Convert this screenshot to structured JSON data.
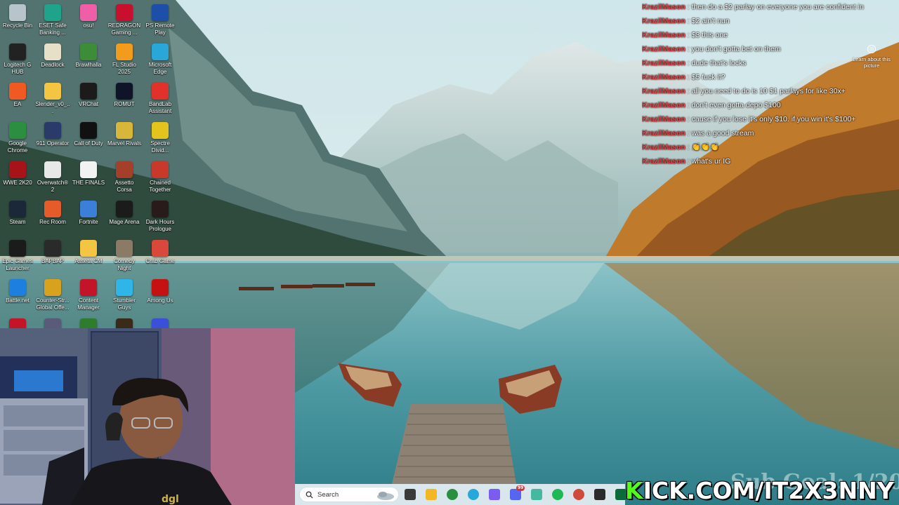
{
  "desktop": {
    "icons": [
      {
        "label": "Recycle Bin",
        "icon": "recycle-bin-icon",
        "color": "#b8c4cc"
      },
      {
        "label": "ESET Safe Banking ...",
        "icon": "eset-icon",
        "color": "#1fa38a"
      },
      {
        "label": "osu!",
        "icon": "osu-icon",
        "color": "#ee5fa8"
      },
      {
        "label": "REDRAGON Gaming ...",
        "icon": "redragon-icon",
        "color": "#c8102e"
      },
      {
        "label": "PS Remote Play",
        "icon": "ps-remote-play-icon",
        "color": "#1d4fa8"
      },
      {
        "label": "Logitech G HUB",
        "icon": "logitech-icon",
        "color": "#222222"
      },
      {
        "label": "Deadlock",
        "icon": "deadlock-icon",
        "color": "#e8dfc8"
      },
      {
        "label": "Brawlhalla",
        "icon": "brawlhalla-icon",
        "color": "#3d8c3a"
      },
      {
        "label": "FL Studio 2025",
        "icon": "fl-studio-icon",
        "color": "#f29b1c"
      },
      {
        "label": "Microsoft Edge",
        "icon": "edge-icon",
        "color": "#2aa7d9"
      },
      {
        "label": "EA",
        "icon": "ea-icon",
        "color": "#f05a22"
      },
      {
        "label": "Slender_v0_...",
        "icon": "folder-icon",
        "color": "#f4c542"
      },
      {
        "label": "VRChat",
        "icon": "vrchat-icon",
        "color": "#1b1b1b"
      },
      {
        "label": "ROMUT",
        "icon": "romut-icon",
        "color": "#101428"
      },
      {
        "label": "BandLab Assistant",
        "icon": "bandlab-icon",
        "color": "#e0322b"
      },
      {
        "label": "Google Chrome",
        "icon": "chrome-icon",
        "color": "#2c8f3f"
      },
      {
        "label": "911 Operator",
        "icon": "911-operator-icon",
        "color": "#2a3b6b"
      },
      {
        "label": "Call of Duty",
        "icon": "call-of-duty-icon",
        "color": "#111111"
      },
      {
        "label": "Marvel Rivals",
        "icon": "marvel-rivals-icon",
        "color": "#d8b63a"
      },
      {
        "label": "Spectre Divid...",
        "icon": "spectre-icon",
        "color": "#e3c31c"
      },
      {
        "label": "WWE 2K20",
        "icon": "wwe-icon",
        "color": "#a8131a"
      },
      {
        "label": "Overwatch® 2",
        "icon": "overwatch-icon",
        "color": "#e8e8e8"
      },
      {
        "label": "THE FINALS",
        "icon": "the-finals-icon",
        "color": "#f2f2f2"
      },
      {
        "label": "Assetto Corsa",
        "icon": "assetto-corsa-icon",
        "color": "#a4402a"
      },
      {
        "label": "Chained Together",
        "icon": "chained-together-icon",
        "color": "#c9392b"
      },
      {
        "label": "Steam",
        "icon": "steam-icon",
        "color": "#1b2838"
      },
      {
        "label": "Rec Room",
        "icon": "rec-room-icon",
        "color": "#e55b2a"
      },
      {
        "label": "Fortnite",
        "icon": "fortnite-icon",
        "color": "#3c7fd9"
      },
      {
        "label": "Mage Arena",
        "icon": "mage-arena-icon",
        "color": "#1b1b1b"
      },
      {
        "label": "Dark Hours Prologue",
        "icon": "dark-hours-icon",
        "color": "#2a1b1b"
      },
      {
        "label": "Epic Games Launcher",
        "icon": "epic-games-icon",
        "color": "#1b1b1b"
      },
      {
        "label": "BAPBAP",
        "icon": "bapbap-icon",
        "color": "#2a2a2a"
      },
      {
        "label": "Asseta CM",
        "icon": "folder-icon",
        "color": "#f4c542"
      },
      {
        "label": "Comedy Night",
        "icon": "comedy-night-icon",
        "color": "#8a7a66"
      },
      {
        "label": "Crab Game",
        "icon": "crab-game-icon",
        "color": "#d9483b"
      },
      {
        "label": "Battle.net",
        "icon": "battlenet-icon",
        "color": "#1d7fe0"
      },
      {
        "label": "Counter-Str... Global Offe...",
        "icon": "csgo-icon",
        "color": "#d9a21c"
      },
      {
        "label": "Content Manager",
        "icon": "content-manager-icon",
        "color": "#c3142a"
      },
      {
        "label": "Stumbler Guys",
        "icon": "stumble-guys-icon",
        "color": "#2fb5e8"
      },
      {
        "label": "Among Us",
        "icon": "among-us-icon",
        "color": "#c51111"
      }
    ]
  },
  "chat": {
    "separator": ":",
    "messages": [
      {
        "user": "KrazilMason",
        "text": "then do a $2 parlay on everyone you are confident in"
      },
      {
        "user": "KrazilMason",
        "text": "$2 ain't nun"
      },
      {
        "user": "KrazilMason",
        "text": "$3 this one"
      },
      {
        "user": "KrazilMason",
        "text": "you don't gotta bet on them"
      },
      {
        "user": "KrazilMason",
        "text": "dude that's locks"
      },
      {
        "user": "KrazilMason",
        "text": "$5 fuck it?"
      },
      {
        "user": "KrazilMason",
        "text": "all you need to do is 10 $1 parlays for like 30x+"
      },
      {
        "user": "KrazilMason",
        "text": "don't even gotta depo $100"
      },
      {
        "user": "KrazilMason",
        "text": "cause if you lose it's only $10. if you win it's $100+"
      },
      {
        "user": "KrazilMason",
        "text": "was a good stream"
      },
      {
        "user": "KrazilMason",
        "text": "👏👏👏"
      },
      {
        "user": "KrazilMason",
        "text": "what's ur IG"
      }
    ]
  },
  "learn_picture": {
    "label": "Learn about this picture"
  },
  "taskbar": {
    "search_placeholder": "Search",
    "apps": [
      {
        "icon": "weather-widget-icon",
        "color": "#9aa7b0"
      },
      {
        "icon": "task-view-icon",
        "color": "#3a3a3a"
      },
      {
        "icon": "file-explorer-icon",
        "color": "#f2b824"
      },
      {
        "icon": "chrome-icon",
        "color": "#2c8f3f"
      },
      {
        "icon": "edge-icon",
        "color": "#2aa7d9"
      },
      {
        "icon": "copilot-icon",
        "color": "#7a5cf0"
      },
      {
        "icon": "discord-icon",
        "color": "#5865f2"
      },
      {
        "icon": "app-icon",
        "color": "#46b8a0"
      },
      {
        "icon": "spotify-icon",
        "color": "#1db954"
      },
      {
        "icon": "chrome-profile-icon",
        "color": "#d04a3c"
      },
      {
        "icon": "obs-icon",
        "color": "#2b2b2b"
      },
      {
        "icon": "terminal-icon",
        "color": "#0b6b3a"
      }
    ],
    "badge_count": "99"
  },
  "overlay": {
    "kick_k": "K",
    "kick_rest": "ICK.COM/IT2X3NNY",
    "sub_goal": "Sub Goal: 1/20"
  }
}
